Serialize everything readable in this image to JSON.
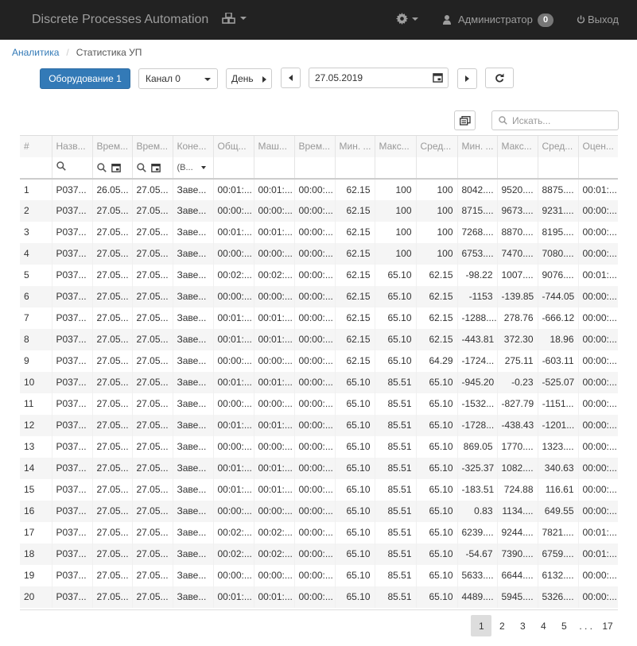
{
  "navbar": {
    "brand": "Discrete Processes Automation",
    "user": "Администратор",
    "badge": "0",
    "logout": "Выход"
  },
  "breadcrumb": {
    "items": [
      "Аналитика",
      "Статистика УП"
    ]
  },
  "toolbar": {
    "equipment_button": "Оборудование 1",
    "channel_value": "Канал 0",
    "period_value": "День",
    "date_value": "27.05.2019"
  },
  "search": {
    "placeholder": "Искать..."
  },
  "table": {
    "headers": [
      "#",
      "Назв...",
      "Врем...",
      "Врем...",
      "Коне...",
      "Общ...",
      "Маш...",
      "Врем...",
      "Мин. ...",
      "Макс...",
      "Сред...",
      "Мин. ...",
      "Макс...",
      "Сред...",
      "Оцен..."
    ],
    "filter_select": "(В...",
    "rows": [
      [
        "1",
        "P037...",
        "26.05...",
        "27.05...",
        "Заве...",
        "00:01:...",
        "00:01:...",
        "00:00:...",
        "62.15",
        "100",
        "100",
        "8042....",
        "9520....",
        "8875....",
        "00:01:..."
      ],
      [
        "2",
        "P037...",
        "27.05...",
        "27.05...",
        "Заве...",
        "00:00:...",
        "00:00:...",
        "00:00:...",
        "62.15",
        "100",
        "100",
        "8715....",
        "9673....",
        "9231....",
        "00:00:..."
      ],
      [
        "3",
        "P037...",
        "27.05...",
        "27.05...",
        "Заве...",
        "00:01:...",
        "00:01:...",
        "00:00:...",
        "62.15",
        "100",
        "100",
        "7268....",
        "8870....",
        "8195....",
        "00:00:..."
      ],
      [
        "4",
        "P037...",
        "27.05...",
        "27.05...",
        "Заве...",
        "00:00:...",
        "00:00:...",
        "00:00:...",
        "62.15",
        "100",
        "100",
        "6753....",
        "7470....",
        "7080....",
        "00:00:..."
      ],
      [
        "5",
        "P037...",
        "27.05...",
        "27.05...",
        "Заве...",
        "00:02:...",
        "00:02:...",
        "00:00:...",
        "62.15",
        "65.10",
        "62.15",
        "-98.22",
        "1007....",
        "9076....",
        "00:01:..."
      ],
      [
        "6",
        "P037...",
        "27.05...",
        "27.05...",
        "Заве...",
        "00:00:...",
        "00:00:...",
        "00:00:...",
        "62.15",
        "65.10",
        "62.15",
        "-1153",
        "-139.85",
        "-744.05",
        "00:00:..."
      ],
      [
        "7",
        "P037...",
        "27.05...",
        "27.05...",
        "Заве...",
        "00:01:...",
        "00:01:...",
        "00:00:...",
        "62.15",
        "65.10",
        "62.15",
        "-1288....",
        "278.76",
        "-666.12",
        "00:00:..."
      ],
      [
        "8",
        "P037...",
        "27.05...",
        "27.05...",
        "Заве...",
        "00:01:...",
        "00:01:...",
        "00:00:...",
        "62.15",
        "65.10",
        "62.15",
        "-443.81",
        "372.30",
        "18.96",
        "00:00:..."
      ],
      [
        "9",
        "P037...",
        "27.05...",
        "27.05...",
        "Заве...",
        "00:00:...",
        "00:00:...",
        "00:00:...",
        "62.15",
        "65.10",
        "64.29",
        "-1724...",
        "275.11",
        "-603.11",
        "00:00:..."
      ],
      [
        "10",
        "P037...",
        "27.05...",
        "27.05...",
        "Заве...",
        "00:01:...",
        "00:01:...",
        "00:00:...",
        "65.10",
        "85.51",
        "65.10",
        "-945.20",
        "-0.23",
        "-525.07",
        "00:00:..."
      ],
      [
        "11",
        "P037...",
        "27.05...",
        "27.05...",
        "Заве...",
        "00:00:...",
        "00:00:...",
        "00:00:...",
        "65.10",
        "85.51",
        "65.10",
        "-1532...",
        "-827.79",
        "-1151...",
        "00:00:..."
      ],
      [
        "12",
        "P037...",
        "27.05...",
        "27.05...",
        "Заве...",
        "00:01:...",
        "00:01:...",
        "00:00:...",
        "65.10",
        "85.51",
        "65.10",
        "-1728...",
        "-438.43",
        "-1201...",
        "00:00:..."
      ],
      [
        "13",
        "P037...",
        "27.05...",
        "27.05...",
        "Заве...",
        "00:00:...",
        "00:00:...",
        "00:00:...",
        "65.10",
        "85.51",
        "65.10",
        "869.05",
        "1770....",
        "1323....",
        "00:00:..."
      ],
      [
        "14",
        "P037...",
        "27.05...",
        "27.05...",
        "Заве...",
        "00:01:...",
        "00:01:...",
        "00:00:...",
        "65.10",
        "85.51",
        "65.10",
        "-325.37",
        "1082....",
        "340.63",
        "00:00:..."
      ],
      [
        "15",
        "P037...",
        "27.05...",
        "27.05...",
        "Заве...",
        "00:01:...",
        "00:01:...",
        "00:00:...",
        "65.10",
        "85.51",
        "65.10",
        "-183.51",
        "724.88",
        "116.61",
        "00:00:..."
      ],
      [
        "16",
        "P037...",
        "27.05...",
        "27.05...",
        "Заве...",
        "00:00:...",
        "00:00:...",
        "00:00:...",
        "65.10",
        "85.51",
        "65.10",
        "0.83",
        "1134....",
        "649.55",
        "00:00:..."
      ],
      [
        "17",
        "P037...",
        "27.05...",
        "27.05...",
        "Заве...",
        "00:02:...",
        "00:02:...",
        "00:00:...",
        "65.10",
        "85.51",
        "65.10",
        "6239....",
        "9244....",
        "7821....",
        "00:01:..."
      ],
      [
        "18",
        "P037...",
        "27.05...",
        "27.05...",
        "Заве...",
        "00:02:...",
        "00:02:...",
        "00:00:...",
        "65.10",
        "85.51",
        "65.10",
        "-54.67",
        "7390....",
        "6759....",
        "00:01:..."
      ],
      [
        "19",
        "P037...",
        "27.05...",
        "27.05...",
        "Заве...",
        "00:00:...",
        "00:00:...",
        "00:00:...",
        "65.10",
        "85.51",
        "65.10",
        "5633....",
        "6644....",
        "6132....",
        "00:00:..."
      ],
      [
        "20",
        "P037...",
        "27.05...",
        "27.05...",
        "Заве...",
        "00:01:...",
        "00:01:...",
        "00:00:...",
        "65.10",
        "85.51",
        "65.10",
        "4489....",
        "5945....",
        "5326....",
        "00:00:..."
      ]
    ]
  },
  "pagination": {
    "pages": [
      "1",
      "2",
      "3",
      "4",
      "5"
    ],
    "ellipsis": ". . .",
    "last": "17",
    "active": "1"
  }
}
